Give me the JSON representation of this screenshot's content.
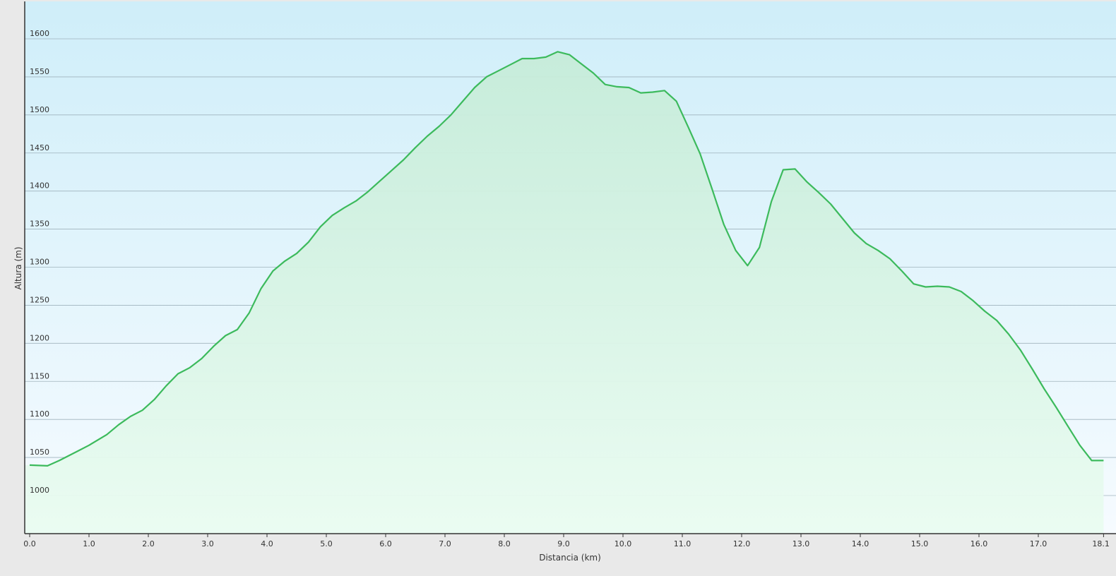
{
  "chart_data": {
    "type": "area",
    "xlabel": "Distancia  (km)",
    "ylabel": "Altura (m)",
    "xlim": [
      0,
      18.1
    ],
    "ylim": [
      950,
      1650
    ],
    "x_ticks": [
      "0.0",
      "1.0",
      "2.0",
      "3.0",
      "4.0",
      "5.0",
      "6.0",
      "7.0",
      "8.0",
      "9.0",
      "10.0",
      "11.0",
      "12.0",
      "13.0",
      "14.0",
      "15.0",
      "16.0",
      "17.0",
      "18.1"
    ],
    "x_tick_values": [
      0,
      1,
      2,
      3,
      4,
      5,
      6,
      7,
      8,
      9,
      10,
      11,
      12,
      13,
      14,
      15,
      16,
      17,
      18.1
    ],
    "y_ticks": [
      "1000",
      "1050",
      "1100",
      "1150",
      "1200",
      "1250",
      "1300",
      "1350",
      "1400",
      "1450",
      "1500",
      "1550",
      "1600"
    ],
    "y_tick_values": [
      1000,
      1050,
      1100,
      1150,
      1200,
      1250,
      1300,
      1350,
      1400,
      1450,
      1500,
      1550,
      1600
    ],
    "grid": "horizontal",
    "line_color": "#3cba5c",
    "fill_color": "#c8f0d8",
    "series": [
      {
        "x": [
          0,
          0.3,
          0.5,
          0.8,
          1.0,
          1.3,
          1.5,
          1.7,
          1.9,
          2.1,
          2.3,
          2.5,
          2.7,
          2.9,
          3.1,
          3.3,
          3.5,
          3.7,
          3.9,
          4.1,
          4.3,
          4.5,
          4.7,
          4.9,
          5.1,
          5.3,
          5.5,
          5.7,
          5.9,
          6.1,
          6.3,
          6.5,
          6.7,
          6.9,
          7.1,
          7.3,
          7.5,
          7.7,
          7.9,
          8.1,
          8.3,
          8.5,
          8.7,
          8.9,
          9.1,
          9.3,
          9.5,
          9.7,
          9.9,
          10.1,
          10.3,
          10.5,
          10.7,
          10.9,
          11.1,
          11.3,
          11.5,
          11.7,
          11.9,
          12.1,
          12.3,
          12.5,
          12.7,
          12.9,
          13.1,
          13.3,
          13.5,
          13.7,
          13.9,
          14.1,
          14.3,
          14.5,
          14.7,
          14.9,
          15.1,
          15.3,
          15.5,
          15.7,
          15.9,
          16.1,
          16.3,
          16.5,
          16.7,
          16.9,
          17.1,
          17.3,
          17.5,
          17.7,
          17.9,
          18.1
        ],
        "values": [
          1040,
          1039,
          1046,
          1058,
          1066,
          1080,
          1093,
          1104,
          1112,
          1126,
          1144,
          1160,
          1168,
          1180,
          1196,
          1210,
          1218,
          1240,
          1272,
          1295,
          1308,
          1318,
          1333,
          1353,
          1368,
          1378,
          1387,
          1399,
          1413,
          1427,
          1441,
          1457,
          1472,
          1485,
          1500,
          1518,
          1536,
          1550,
          1558,
          1566,
          1574,
          1574,
          1576,
          1583,
          1579,
          1567,
          1555,
          1540,
          1537,
          1536,
          1529,
          1530,
          1532,
          1518,
          1484,
          1449,
          1403,
          1356,
          1322,
          1302,
          1326,
          1386,
          1428,
          1429,
          1412,
          1398,
          1383,
          1364,
          1345,
          1331,
          1322,
          1311,
          1295,
          1278,
          1274,
          1275,
          1274,
          1268,
          1256,
          1242,
          1230,
          1212,
          1191,
          1166,
          1140,
          1116,
          1091,
          1066,
          1046,
          1046
        ]
      }
    ]
  }
}
